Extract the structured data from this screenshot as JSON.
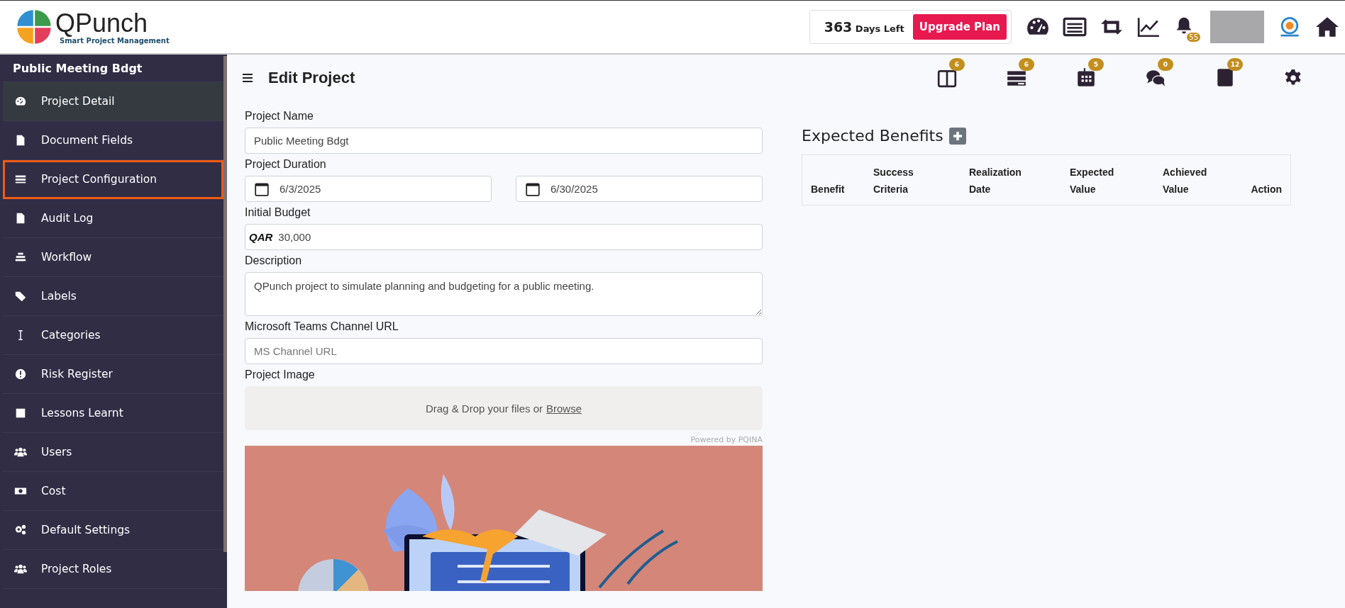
{
  "brand": {
    "name": "QPunch",
    "tagline": "Smart Project Management"
  },
  "plan": {
    "days": "363",
    "days_label": "Days Left",
    "upgrade": "Upgrade Plan"
  },
  "notifications": {
    "count": "55"
  },
  "sidebar": {
    "title": "Public Meeting Bdgt",
    "items": [
      {
        "label": "Project Detail",
        "selected": true,
        "focused": false
      },
      {
        "label": "Document Fields",
        "selected": false,
        "focused": false
      },
      {
        "label": "Project Configuration",
        "selected": false,
        "focused": true
      },
      {
        "label": "Audit Log",
        "selected": false,
        "focused": false
      },
      {
        "label": "Workflow",
        "selected": false,
        "focused": false
      },
      {
        "label": "Labels",
        "selected": false,
        "focused": false
      },
      {
        "label": "Categories",
        "selected": false,
        "focused": false
      },
      {
        "label": "Risk Register",
        "selected": false,
        "focused": false
      },
      {
        "label": "Lessons Learnt",
        "selected": false,
        "focused": false
      },
      {
        "label": "Users",
        "selected": false,
        "focused": false
      },
      {
        "label": "Cost",
        "selected": false,
        "focused": false
      },
      {
        "label": "Default Settings",
        "selected": false,
        "focused": false
      },
      {
        "label": "Project Roles",
        "selected": false,
        "focused": false
      }
    ]
  },
  "page": {
    "title": "Edit Project"
  },
  "toolbar": [
    {
      "badge": "6"
    },
    {
      "badge": "6"
    },
    {
      "badge": "5"
    },
    {
      "badge": "0"
    },
    {
      "badge": "12"
    }
  ],
  "form": {
    "project_name": {
      "label": "Project Name",
      "value": "Public Meeting Bdgt"
    },
    "duration": {
      "label": "Project Duration",
      "start": "6/3/2025",
      "end": "6/30/2025"
    },
    "budget": {
      "label": "Initial Budget",
      "currency": "QAR",
      "value": "30,000"
    },
    "description": {
      "label": "Description",
      "value": "QPunch project to simulate planning and budgeting for a public meeting."
    },
    "teams_url": {
      "label": "Microsoft Teams Channel URL",
      "placeholder": "MS Channel URL"
    },
    "image": {
      "label": "Project Image",
      "drop_text": "Drag & Drop your files or",
      "browse": "Browse",
      "powered_by": "Powered by PQINA"
    }
  },
  "benefits": {
    "title": "Expected Benefits",
    "columns": [
      "Benefit",
      "Success Criteria",
      "Realization Date",
      "Expected Value",
      "Achieved Value",
      "Action"
    ]
  }
}
